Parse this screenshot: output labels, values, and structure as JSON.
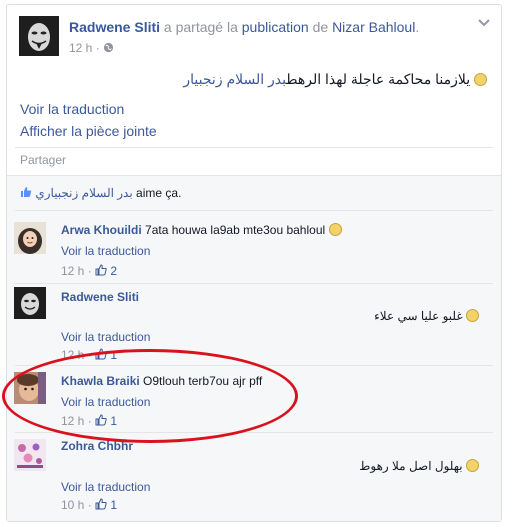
{
  "post": {
    "author": "Radwene Sliti",
    "action_text": "a partagé la",
    "publication_link": "publication",
    "de_text": "de",
    "original_author": "Nizar Bahloul",
    "time": "12 h",
    "separator": "·",
    "message_link": "بدر السلام زنجبيار",
    "message_text": "يلازمنا محاكمة عاجلة لهذا الرهط",
    "translate": "Voir la traduction",
    "attachment": "Afficher la pièce jointe",
    "share": "Partager"
  },
  "likes": {
    "name": "بدر السلام زنجبياري",
    "text": "aime ça."
  },
  "comments": [
    {
      "author": "Arwa Khouildi",
      "text": "7ata houwa la9ab mte3ou bahloul",
      "translate": "Voir la traduction",
      "time": "12 h",
      "likes": "2"
    },
    {
      "author": "Radwene Sliti",
      "text": "غلبو عليا سي علاء",
      "translate": "Voir la traduction",
      "time": "12 h",
      "likes": "1"
    },
    {
      "author": "Khawla Braiki",
      "text": "O9tlouh terb7ou ajr pff",
      "translate": "Voir la traduction",
      "time": "12 h",
      "likes": "1"
    },
    {
      "author": "Zohra Chbhr",
      "text": "بهلول اصل ملا رهوط",
      "translate": "Voir la traduction",
      "time": "10 h",
      "likes": "1"
    }
  ],
  "colors": {
    "link": "#3b5998",
    "grey": "#90949c",
    "highlight_ring": "#d9131e"
  }
}
